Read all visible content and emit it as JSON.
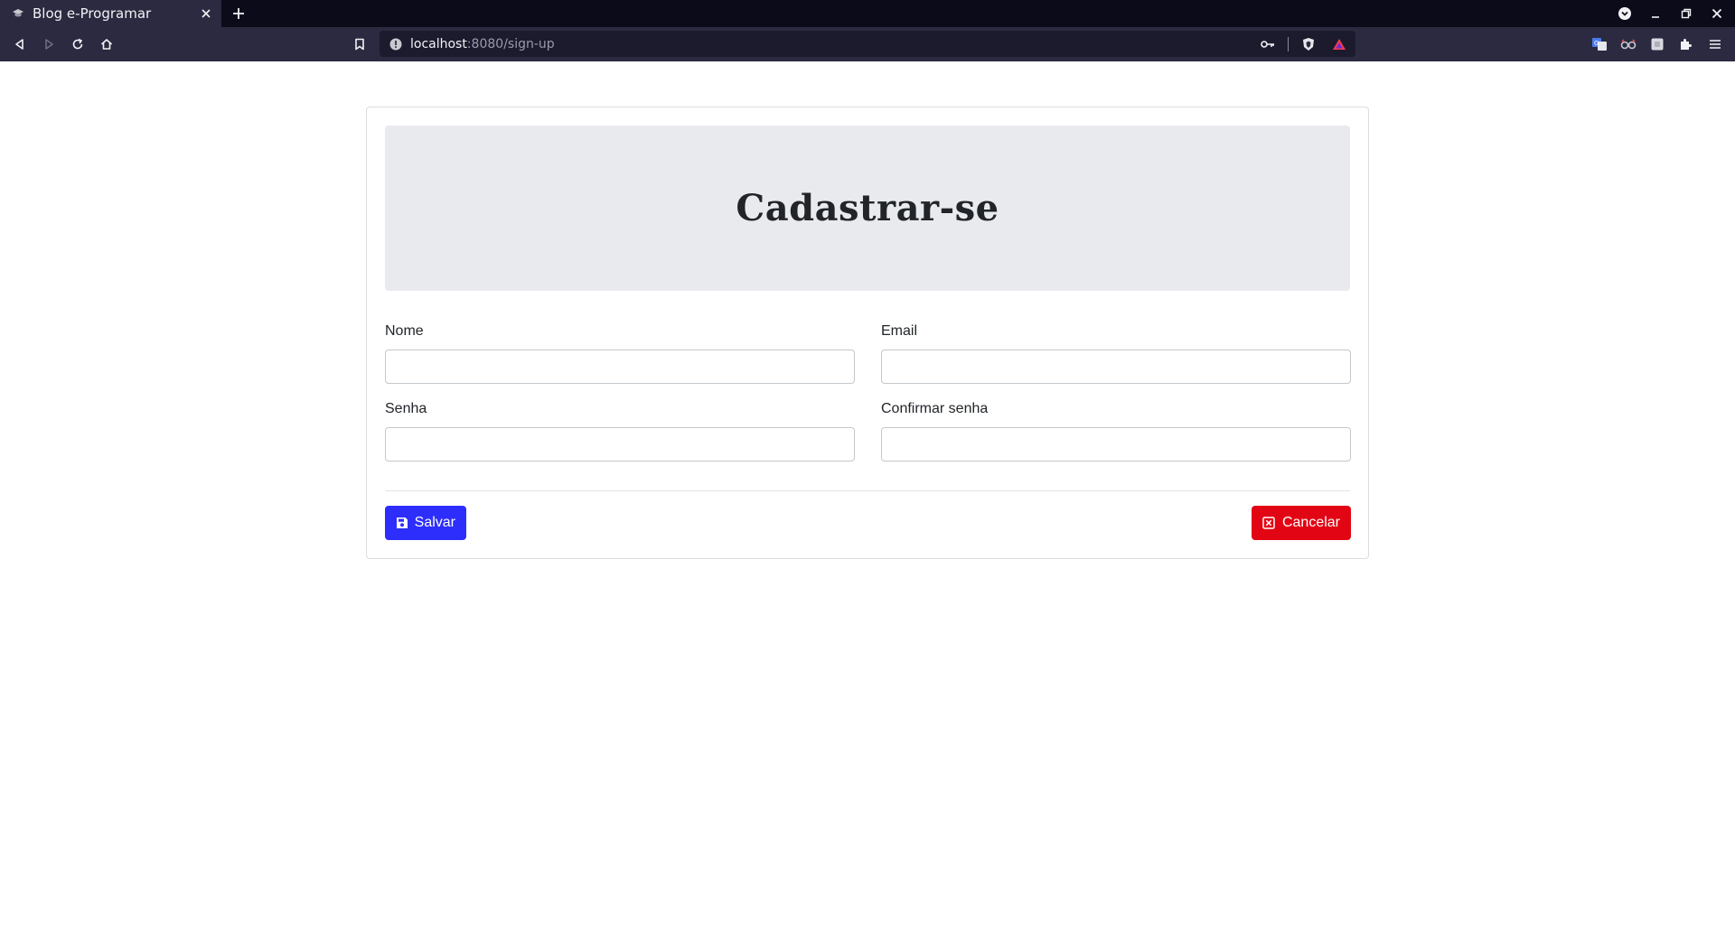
{
  "browser": {
    "tab": {
      "title": "Blog e-Programar"
    },
    "url": {
      "host": "localhost",
      "rest": ":8080/sign-up"
    }
  },
  "page": {
    "heading": "Cadastrar-se",
    "fields": {
      "nome": {
        "label": "Nome",
        "value": ""
      },
      "email": {
        "label": "Email",
        "value": ""
      },
      "senha": {
        "label": "Senha",
        "value": ""
      },
      "confirmar": {
        "label": "Confirmar senha",
        "value": ""
      }
    },
    "buttons": {
      "save": "Salvar",
      "cancel": "Cancelar"
    }
  },
  "colors": {
    "save_button": "#2e2efc",
    "cancel_button": "#e20514",
    "jumbotron": "#e9eaed",
    "chrome": "#2b2a40"
  }
}
